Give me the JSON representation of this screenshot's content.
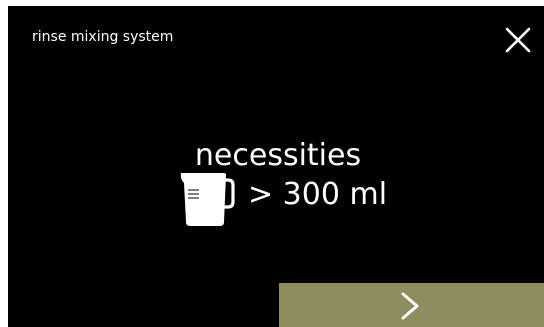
{
  "header": {
    "title": "rinse mixing system",
    "close_icon": "close-icon"
  },
  "main": {
    "heading": "necessities",
    "requirement_icon": "measuring-jug-icon",
    "volume_text": "> 300 ml"
  },
  "footer": {
    "next_icon": "chevron-right-icon"
  },
  "colors": {
    "background": "#000000",
    "text": "#ffffff",
    "next_button": "#8f8c5f"
  }
}
